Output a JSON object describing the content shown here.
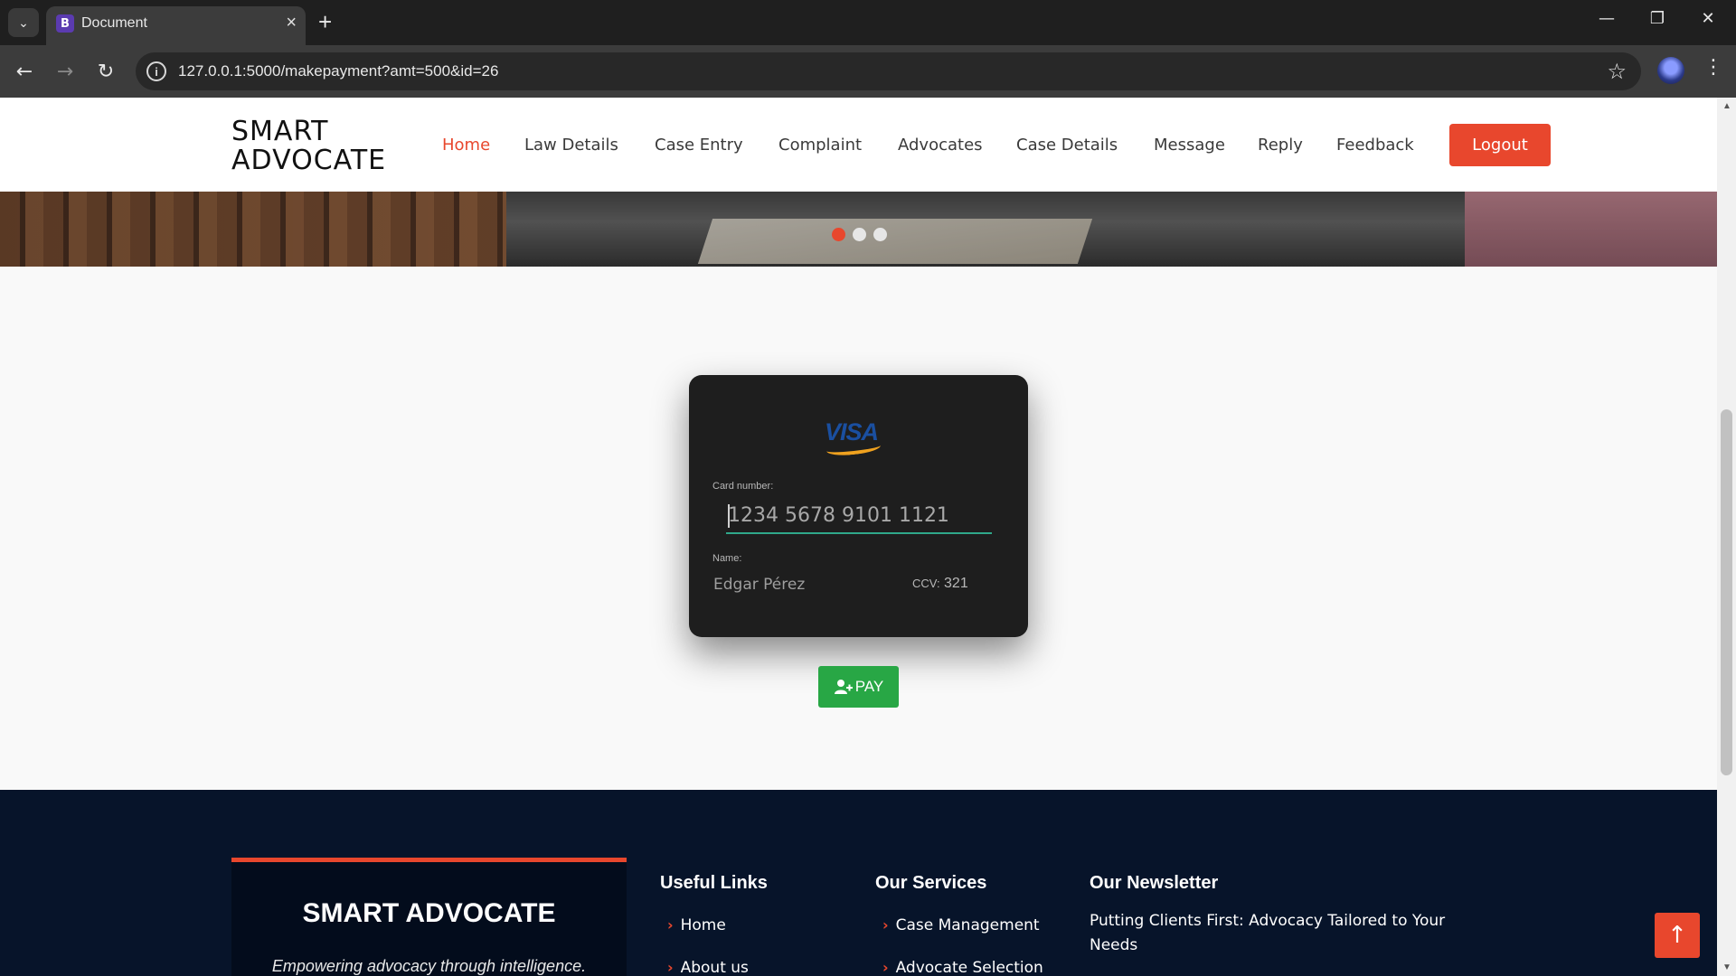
{
  "browser": {
    "tab_title": "Document",
    "tab_favicon_letter": "B",
    "url": "127.0.0.1:5000/makepayment?amt=500&id=26"
  },
  "header": {
    "logo_line1": "SMART",
    "logo_line2": "ADVOCATE",
    "nav": [
      "Home",
      "Law Details",
      "Case Entry",
      "Complaint",
      "Advocates",
      "Case Details",
      "Message",
      "Reply",
      "Feedback"
    ],
    "active_nav": "Home",
    "logout_label": "Logout"
  },
  "carousel": {
    "slide_count": 3,
    "active_index": 0
  },
  "payment_card": {
    "brand": "VISA",
    "card_number_label": "Card number:",
    "card_number_placeholder": "1234 5678 9101 1121",
    "name_label": "Name:",
    "name_placeholder": "Edgar Pérez",
    "ccv_label": "CCV:",
    "ccv_value": "321"
  },
  "pay_button_label": "PAY",
  "footer": {
    "brand_title": "SMART ADVOCATE",
    "brand_tagline": "Empowering advocacy through intelligence.",
    "useful_links_title": "Useful Links",
    "useful_links": [
      "Home",
      "About us"
    ],
    "services_title": "Our Services",
    "services": [
      "Case Management",
      "Advocate Selection"
    ],
    "newsletter_title": "Our Newsletter",
    "newsletter_text": "Putting Clients First: Advocacy Tailored to Your Needs"
  },
  "colors": {
    "accent": "#e8472d",
    "pay_green": "#28a745",
    "footer_bg": "#07142a",
    "card_bg": "#1e1e1e"
  }
}
